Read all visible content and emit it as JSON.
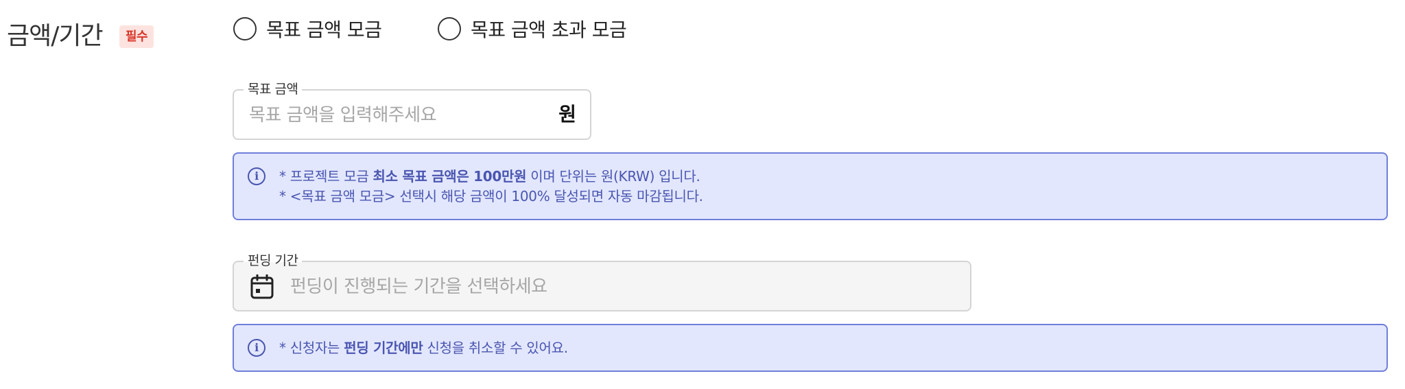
{
  "section": {
    "title": "금액/기간",
    "required_badge": "필수"
  },
  "goal_type": {
    "options": [
      {
        "label": "목표 금액 모금",
        "selected": false
      },
      {
        "label": "목표 금액 초과 모금",
        "selected": false
      }
    ]
  },
  "amount_field": {
    "legend": "목표 금액",
    "placeholder": "목표 금액을 입력해주세요",
    "value": "",
    "unit": "원"
  },
  "amount_info": {
    "icon": "info-icon",
    "line1_prefix": "* 프로젝트 모금 ",
    "line1_bold": "최소 목표 금액은 100만원",
    "line1_suffix": " 이며 단위는 원(KRW) 입니다.",
    "line2": "* <목표 금액 모금> 선택시 해당 금액이 100% 달성되면 자동 마감됩니다."
  },
  "period_field": {
    "legend": "펀딩 기간",
    "icon": "calendar-icon",
    "placeholder": "펀딩이 진행되는 기간을 선택하세요",
    "value": ""
  },
  "period_info": {
    "icon": "info-icon",
    "line1_prefix": "* 신청자는 ",
    "line1_bold": "펀딩 기간에만",
    "line1_suffix": " 신청을 취소할 수 있어요."
  },
  "colors": {
    "badge_bg": "#fde3df",
    "badge_text": "#d8352a",
    "info_bg": "#e2e7fd",
    "info_border": "#6f7ed9",
    "info_text": "#4a55b0",
    "placeholder_text": "#a6a6a6"
  }
}
